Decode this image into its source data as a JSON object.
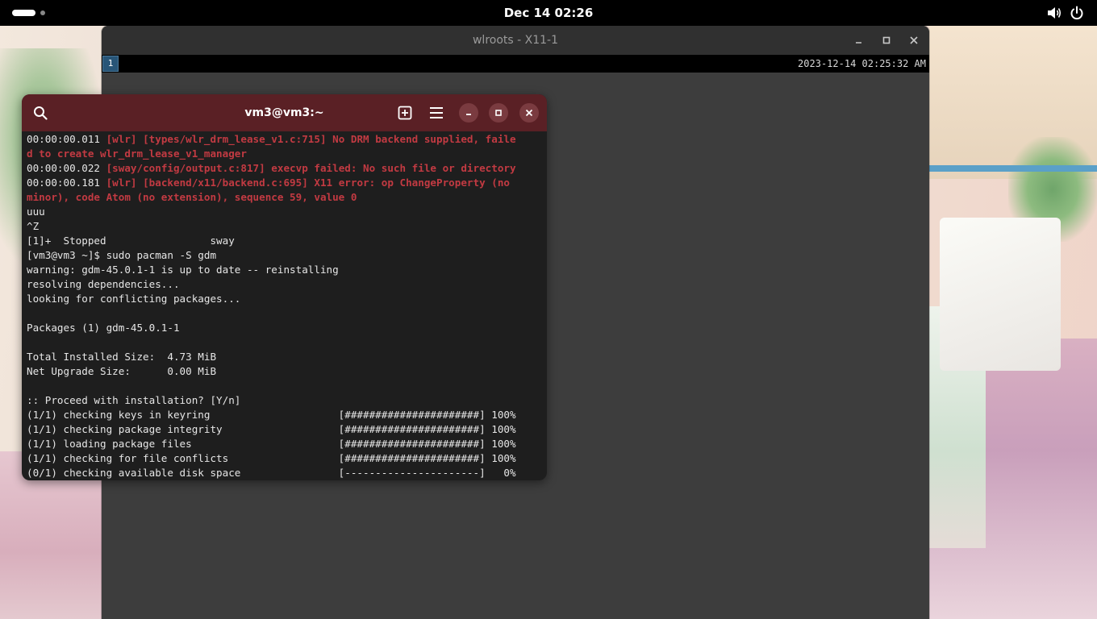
{
  "topbar": {
    "clock": "Dec 14  02:26",
    "icons": [
      "activities-pill",
      "workspace-dot",
      "volume-icon",
      "power-icon"
    ]
  },
  "x11_window": {
    "title": "wlroots - X11-1",
    "workspace": "1",
    "status": "2023-12-14 02:25:32 AM",
    "buttons": [
      "minimize-icon",
      "maximize-icon",
      "close-icon"
    ]
  },
  "terminal": {
    "title": "vm3@vm3:~",
    "header_icons": [
      "search-icon",
      "new-tab-icon",
      "menu-icon",
      "minimize-icon",
      "maximize-icon",
      "close-icon"
    ],
    "colors": {
      "header": "#5a2025",
      "error": "#c23a42",
      "background": "#1e1e1e"
    },
    "lines": [
      {
        "ts": "00:00:00.011 ",
        "msg": "[wlr] [types/wlr_drm_lease_v1.c:715] No DRM backend supplied, faile"
      },
      {
        "ts": "",
        "msg": "d to create wlr_drm_lease_v1_manager"
      },
      {
        "ts": "00:00:00.022 ",
        "msg": "[sway/config/output.c:817] execvp failed: No such file or directory"
      },
      {
        "ts": "00:00:00.181 ",
        "msg": "[wlr] [backend/x11/backend.c:695] X11 error: op ChangeProperty (no"
      },
      {
        "ts": "",
        "msg": "minor), code Atom (no extension), sequence 59, value 0"
      },
      {
        "ts": "uuu",
        "msg": ""
      },
      {
        "ts": "^Z",
        "msg": ""
      },
      {
        "ts": "[1]+  Stopped                 sway",
        "msg": ""
      },
      {
        "ts": "[vm3@vm3 ~]$ sudo pacman -S gdm",
        "msg": ""
      },
      {
        "ts": "warning: gdm-45.0.1-1 is up to date -- reinstalling",
        "msg": ""
      },
      {
        "ts": "resolving dependencies...",
        "msg": ""
      },
      {
        "ts": "looking for conflicting packages...",
        "msg": ""
      },
      {
        "ts": "",
        "msg": ""
      },
      {
        "ts": "Packages (1) gdm-45.0.1-1",
        "msg": ""
      },
      {
        "ts": "",
        "msg": ""
      },
      {
        "ts": "Total Installed Size:  4.73 MiB",
        "msg": ""
      },
      {
        "ts": "Net Upgrade Size:      0.00 MiB",
        "msg": ""
      },
      {
        "ts": "",
        "msg": ""
      },
      {
        "ts": ":: Proceed with installation? [Y/n]",
        "msg": ""
      },
      {
        "ts": "(1/1) checking keys in keyring                     [######################] 100%",
        "msg": ""
      },
      {
        "ts": "(1/1) checking package integrity                   [######################] 100%",
        "msg": ""
      },
      {
        "ts": "(1/1) loading package files                        [######################] 100%",
        "msg": ""
      },
      {
        "ts": "(1/1) checking for file conflicts                  [######################] 100%",
        "msg": ""
      },
      {
        "ts": "(0/1) checking available disk space                [----------------------]   0%",
        "msg": ""
      }
    ]
  }
}
